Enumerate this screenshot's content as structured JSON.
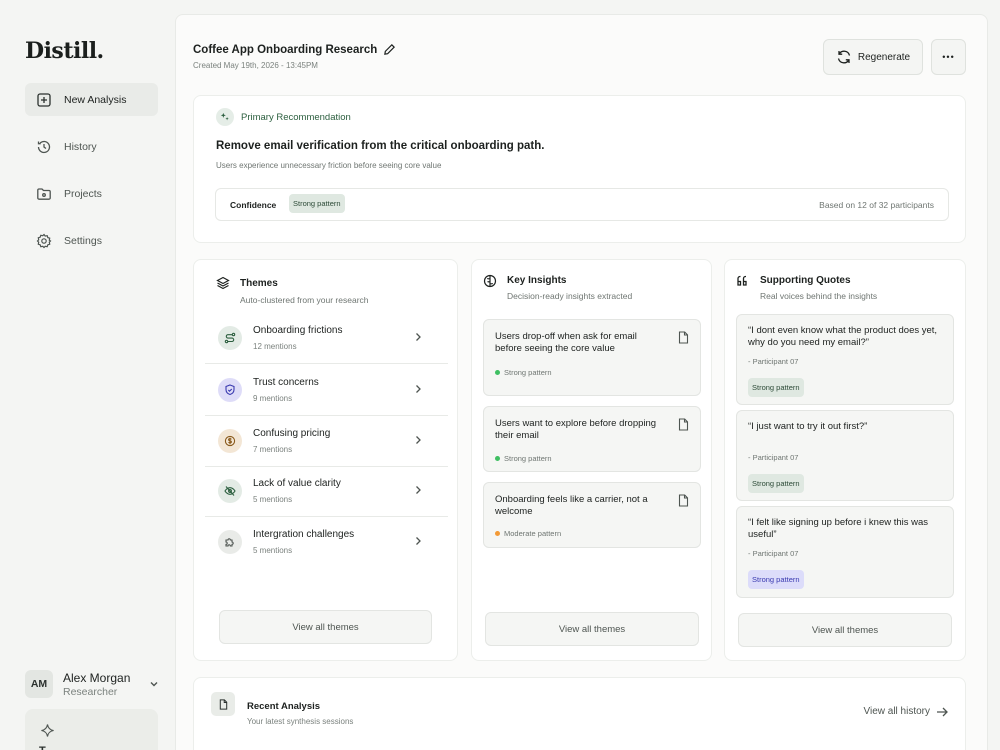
{
  "app": {
    "logo": "Distill."
  },
  "sidebar": {
    "items": [
      {
        "label": "New Analysis",
        "icon": "plus-square-icon"
      },
      {
        "label": "History",
        "icon": "history-icon"
      },
      {
        "label": "Projects",
        "icon": "folder-icon"
      },
      {
        "label": "Settings",
        "icon": "gear-icon"
      }
    ],
    "user": {
      "initials": "AM",
      "name": "Alex Morgan",
      "role": "Researcher"
    },
    "promo": {
      "text": "T"
    }
  },
  "header": {
    "title": "Coffee App Onboarding Research",
    "created": "Created May 19th, 2026 - 13:45PM",
    "regenerate_label": "Regenerate",
    "more_label": "•••"
  },
  "recommendation": {
    "label": "Primary Recommendation",
    "title": "Remove email verification from the critical onboarding path.",
    "subtitle": "Users experience unnecessary friction before seeing core value",
    "confidence_label": "Confidence",
    "confidence_value": "Strong pattern",
    "based_on": "Based on 12 of 32 participants"
  },
  "themes": {
    "title": "Themes",
    "subtitle": "Auto-clustered from your research",
    "items": [
      {
        "name": "Onboarding frictions",
        "mentions": "12 mentions",
        "color": "#e3ebe5"
      },
      {
        "name": "Trust concerns",
        "mentions": "9 mentions",
        "color": "#dedcf8"
      },
      {
        "name": "Confusing pricing",
        "mentions": "7 mentions",
        "color": "#f3e6d5"
      },
      {
        "name": "Lack of value clarity",
        "mentions": "5 mentions",
        "color": "#e3ebe5"
      },
      {
        "name": "Intergration challenges",
        "mentions": "5 mentions",
        "color": "#e9ebe8"
      }
    ],
    "view_all": "View all themes"
  },
  "insights": {
    "title": "Key Insights",
    "subtitle": "Decision-ready insights extracted",
    "items": [
      {
        "text": "Users drop-off when ask for email before seeing the core value",
        "tag": "Strong pattern",
        "dot": "#3fbf62"
      },
      {
        "text": "Users want to explore before dropping their email",
        "tag": "Strong pattern",
        "dot": "#3fbf62"
      },
      {
        "text": "Onboarding feels like a carrier, not a welcome",
        "tag": "Moderate pattern",
        "dot": "#f39a36"
      }
    ],
    "view_all": "View all themes"
  },
  "quotes": {
    "title": "Supporting Quotes",
    "subtitle": "Real voices behind the insights",
    "items": [
      {
        "text": "“I dont even know what the product does yet, why do you need my email?”",
        "by": "- Participant 07",
        "tag": "Strong pattern"
      },
      {
        "text": "“I just want to try it out first?”",
        "by": "- Participant 07",
        "tag": "Strong pattern"
      },
      {
        "text": "“I felt like signing up before i knew this was useful”",
        "by": "- Participant 07",
        "tag": "Strong pattern"
      }
    ],
    "view_all": "View all themes"
  },
  "recent": {
    "title": "Recent Analysis",
    "subtitle": "Your latest synthesis sessions",
    "view_all": "View all history"
  }
}
